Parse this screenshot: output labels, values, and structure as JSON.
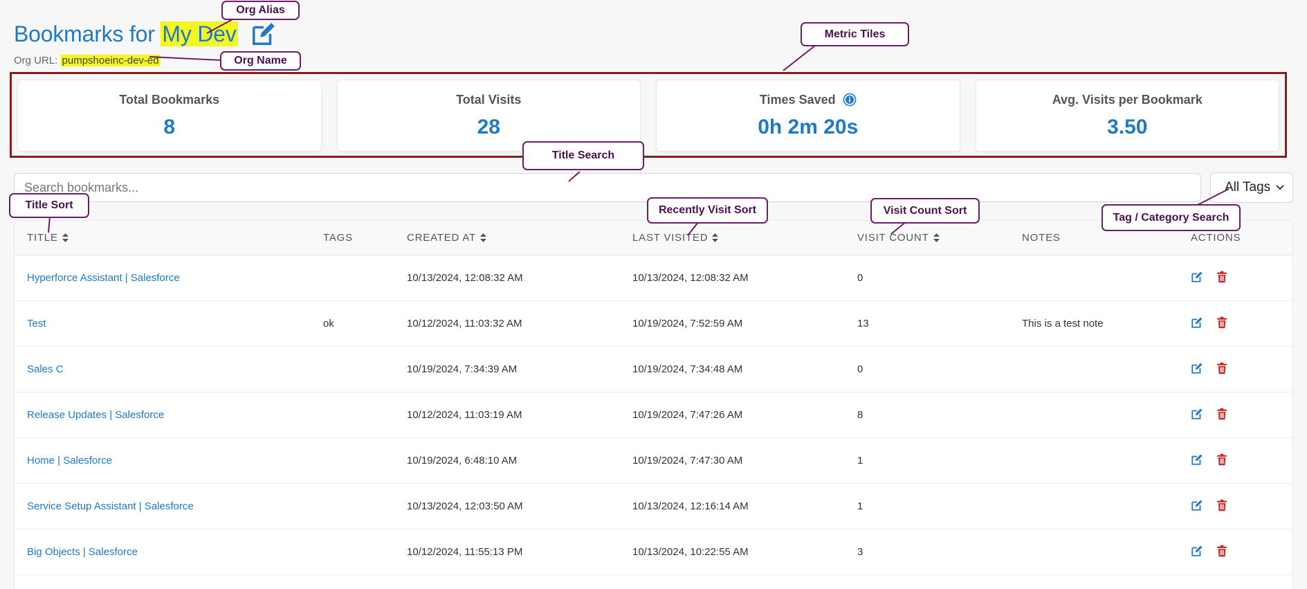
{
  "header": {
    "title_prefix": "Bookmarks for ",
    "org_alias": "My Dev",
    "org_url_label": "Org URL: ",
    "org_name": "pumpshoeinc-dev-ed"
  },
  "metrics": [
    {
      "label": "Total Bookmarks",
      "value": "8"
    },
    {
      "label": "Total Visits",
      "value": "28"
    },
    {
      "label": "Times Saved",
      "value": "0h 2m 20s"
    },
    {
      "label": "Avg. Visits per Bookmark",
      "value": "3.50"
    }
  ],
  "search": {
    "placeholder": "Search bookmarks..."
  },
  "tag_filter": {
    "selected": "All Tags"
  },
  "table": {
    "headers": {
      "title": "TITLE",
      "tags": "TAGS",
      "created_at": "CREATED AT",
      "last_visited": "LAST VISITED",
      "visit_count": "VISIT COUNT",
      "notes": "NOTES",
      "actions": "ACTIONS"
    },
    "rows": [
      {
        "title": "Hyperforce Assistant | Salesforce",
        "tags": "",
        "created_at": "10/13/2024, 12:08:32 AM",
        "last_visited": "10/13/2024, 12:08:32 AM",
        "visit_count": "0",
        "notes": ""
      },
      {
        "title": "Test",
        "tags": "ok",
        "created_at": "10/12/2024, 11:03:32 AM",
        "last_visited": "10/19/2024, 7:52:59 AM",
        "visit_count": "13",
        "notes": "This is a test note"
      },
      {
        "title": "Sales C",
        "tags": "",
        "created_at": "10/19/2024, 7:34:39 AM",
        "last_visited": "10/19/2024, 7:34:48 AM",
        "visit_count": "0",
        "notes": ""
      },
      {
        "title": "Release Updates | Salesforce",
        "tags": "",
        "created_at": "10/12/2024, 11:03:19 AM",
        "last_visited": "10/19/2024, 7:47:26 AM",
        "visit_count": "8",
        "notes": ""
      },
      {
        "title": "Home | Salesforce",
        "tags": "",
        "created_at": "10/19/2024, 6:48:10 AM",
        "last_visited": "10/19/2024, 7:47:30 AM",
        "visit_count": "1",
        "notes": ""
      },
      {
        "title": "Service Setup Assistant | Salesforce",
        "tags": "",
        "created_at": "10/13/2024, 12:03:50 AM",
        "last_visited": "10/13/2024, 12:16:14 AM",
        "visit_count": "1",
        "notes": ""
      },
      {
        "title": "Big Objects | Salesforce",
        "tags": "",
        "created_at": "10/12/2024, 11:55:13 PM",
        "last_visited": "10/13/2024, 10:22:55 AM",
        "visit_count": "3",
        "notes": ""
      }
    ]
  },
  "callouts": {
    "org_alias": "Org Alias",
    "org_name": "Org Name",
    "metric_tiles": "Metric Tiles",
    "title_search": "Title Search",
    "title_sort": "Title Sort",
    "recently_visit_sort": "Recently Visit Sort",
    "visit_count_sort": "Visit Count Sort",
    "tag_category_search": "Tag / Category Search"
  },
  "colors": {
    "accent": "#1f79c9",
    "highlight": "#f5f520",
    "callout_border": "#6b1c6b",
    "tile_frame": "#8b1c1c",
    "delete": "#c62828"
  },
  "icons": {
    "edit": "edit-icon",
    "delete": "trash-icon",
    "info": "info-icon",
    "sort": "sort-icon"
  }
}
